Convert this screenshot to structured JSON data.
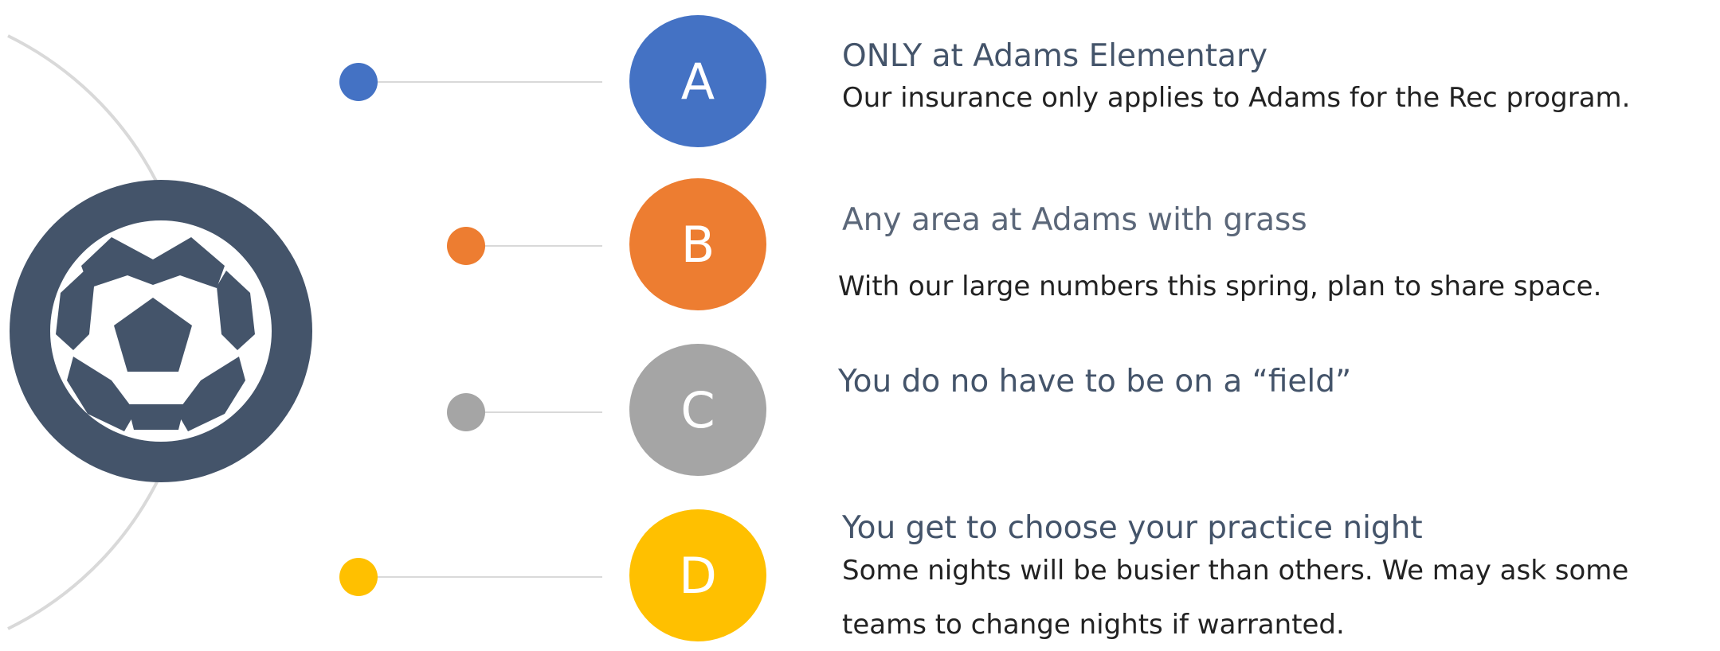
{
  "colors": {
    "a": "#4472c4",
    "b": "#ed7d31",
    "c": "#a5a5a5",
    "d": "#ffc000",
    "ball_circle": "#44546a",
    "orbit": "#d9d9d9"
  },
  "icon": "soccer-ball-icon",
  "items": [
    {
      "letter": "A",
      "title": "ONLY at Adams Elementary",
      "lines": [
        "Our insurance only applies to Adams for the Rec program."
      ]
    },
    {
      "letter": "B",
      "title": "Any area at Adams with grass",
      "lines": [
        "With our large numbers this spring, plan to share space."
      ]
    },
    {
      "letter": "C",
      "title": "You do no have to be on a “field”",
      "lines": []
    },
    {
      "letter": "D",
      "title": "You get to choose your practice night",
      "lines": [
        "Some nights will be busier than others.  We may ask some",
        "teams to change nights if warranted."
      ]
    }
  ]
}
